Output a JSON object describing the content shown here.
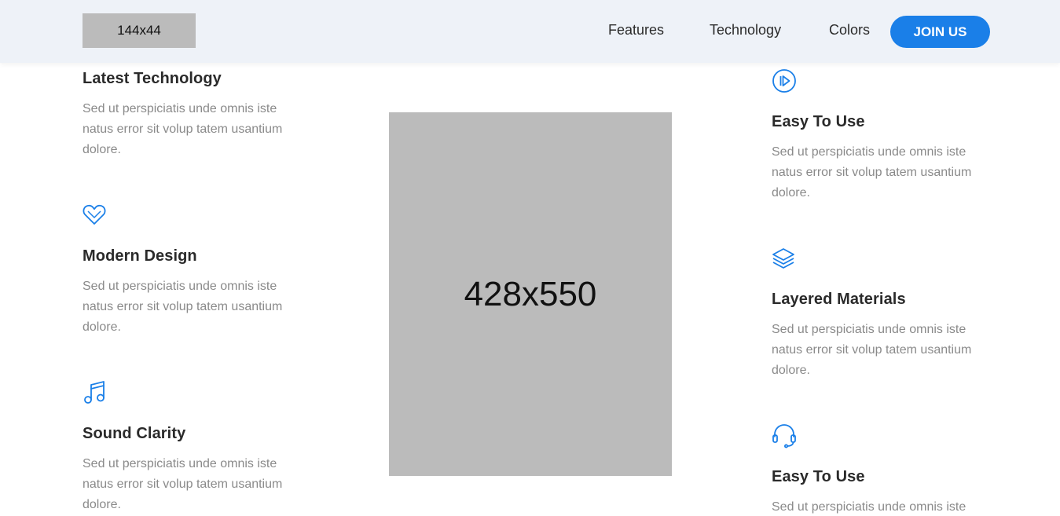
{
  "header": {
    "logo_label": "144x44",
    "nav": {
      "features": "Features",
      "technology": "Technology",
      "colors": "Colors"
    },
    "join_label": "JOIN US"
  },
  "image_placeholder": "428x550",
  "left_features": [
    {
      "title": "Latest Technology",
      "desc": "Sed ut perspiciatis unde omnis iste natus error sit volup tatem usantium dolore.",
      "icon": "none"
    },
    {
      "title": "Modern Design",
      "desc": "Sed ut perspiciatis unde omnis iste natus error sit volup tatem usantium dolore.",
      "icon": "heart-icon"
    },
    {
      "title": "Sound Clarity",
      "desc": "Sed ut perspiciatis unde omnis iste natus error sit volup tatem usantium dolore.",
      "icon": "music-note-icon"
    }
  ],
  "right_features": [
    {
      "title": "Easy To Use",
      "desc": "Sed ut perspiciatis unde omnis iste natus error sit volup tatem usantium dolore.",
      "icon": "play-circle-icon"
    },
    {
      "title": "Layered Materials",
      "desc": "Sed ut perspiciatis unde omnis iste natus error sit volup tatem usantium dolore.",
      "icon": "layers-icon"
    },
    {
      "title": "Easy To Use",
      "desc": "Sed ut perspiciatis unde omnis iste",
      "icon": "headset-icon"
    }
  ],
  "colors": {
    "accent": "#1a7fe8",
    "header_bg": "#eef2f8",
    "placeholder_bg": "#bbbbbb"
  }
}
